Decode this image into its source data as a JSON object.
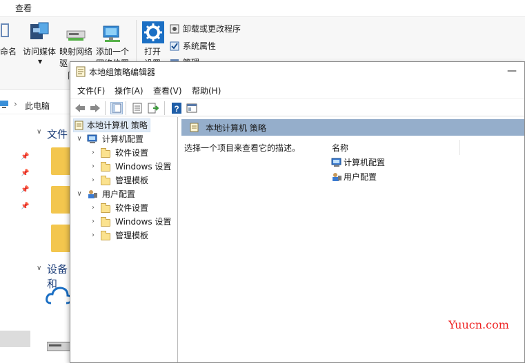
{
  "explorer": {
    "tab_view": "查看",
    "ribbon": {
      "rename_fragment": "命名",
      "access_media": "访问媒体",
      "map_network_1": "映射网络",
      "map_network_2": "驱",
      "map_network_3": "队",
      "add_location_1": "添加一个",
      "add_location_2": "网络位置",
      "open_1": "打开",
      "open_2": "设置",
      "uninstall": "卸载或更改程序",
      "system_properties": "系统属性",
      "manage": "管理"
    },
    "address_pc": "此电脑",
    "section_folders": "文件",
    "section_devices": "设备和"
  },
  "gpedit": {
    "title": "本地组策略编辑器",
    "minimize_glyph": "—",
    "menu": [
      "文件(F)",
      "操作(A)",
      "查看(V)",
      "帮助(H)"
    ],
    "tree": {
      "root": "本地计算机 策略",
      "computer_config": "计算机配置",
      "user_config": "用户配置",
      "software_settings": "软件设置",
      "windows_settings": "Windows 设置",
      "admin_templates": "管理模板"
    },
    "right": {
      "header": "本地计算机 策略",
      "description": "选择一个项目来查看它的描述。",
      "column_name": "名称",
      "items": [
        "计算机配置",
        "用户配置"
      ]
    }
  },
  "watermark": "Yuucn.com",
  "colors": {
    "header_blue": "#95aecb",
    "tree_select": "#dfeaf6",
    "folder": "#fbe28e",
    "watermark": "#ee2222"
  }
}
